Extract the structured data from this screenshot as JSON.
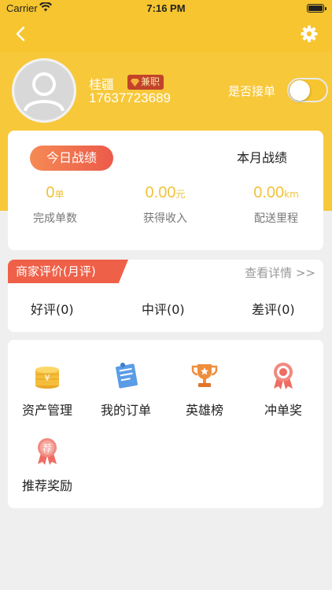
{
  "status_bar": {
    "carrier": "Carrier",
    "time": "7:16 PM"
  },
  "nav": {
    "back_icon": "chevron-left-icon",
    "settings_icon": "gear-icon"
  },
  "profile": {
    "name": "桂疆",
    "badge": "兼职",
    "phone": "17637723689",
    "accept_orders_label": "是否接单",
    "accept_orders_on": false
  },
  "performance": {
    "tabs": [
      "今日战绩",
      "本月战绩"
    ],
    "active_tab": 0,
    "stats": [
      {
        "value": "0",
        "unit": "单",
        "label": "完成单数"
      },
      {
        "value": "0.00",
        "unit": "元",
        "label": "获得收入"
      },
      {
        "value": "0.00",
        "unit": "km",
        "label": "配送里程"
      }
    ]
  },
  "evaluation": {
    "title": "商家评价(月评)",
    "detail_link": "查看详情 >>",
    "items": [
      "好评(0)",
      "中评(0)",
      "差评(0)"
    ]
  },
  "menu": {
    "items": [
      {
        "label": "资产管理",
        "icon": "coins-icon"
      },
      {
        "label": "我的订单",
        "icon": "order-note-icon"
      },
      {
        "label": "英雄榜",
        "icon": "trophy-icon"
      },
      {
        "label": "冲单奖",
        "icon": "medal-icon"
      },
      {
        "label": "推荐奖励",
        "icon": "recommend-medal-icon"
      }
    ]
  },
  "colors": {
    "brand_yellow": "#f6c52f",
    "accent_red": "#ef6048",
    "value_gold": "#f0c33a"
  }
}
